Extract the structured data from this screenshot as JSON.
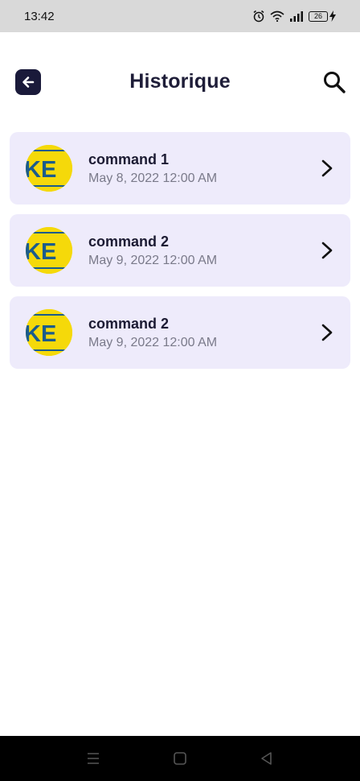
{
  "status_bar": {
    "time": "13:42",
    "battery": "26"
  },
  "header": {
    "title": "Historique"
  },
  "history": [
    {
      "title": "command 1",
      "date": "May 8, 2022 12:00 AM",
      "logo_text": "KE"
    },
    {
      "title": "command 2",
      "date": "May 9, 2022 12:00 AM",
      "logo_text": "KE"
    },
    {
      "title": "command 2",
      "date": "May 9, 2022 12:00 AM",
      "logo_text": "KE"
    }
  ],
  "colors": {
    "card_bg": "#eeebfb",
    "title": "#1e1d38",
    "logo_yellow": "#f5d90a",
    "logo_blue": "#1b5c8c",
    "back_button_bg": "#1a1a3a"
  },
  "icons": {
    "back": "arrow-left-icon",
    "search": "search-icon",
    "chevron": "chevron-right-icon"
  }
}
